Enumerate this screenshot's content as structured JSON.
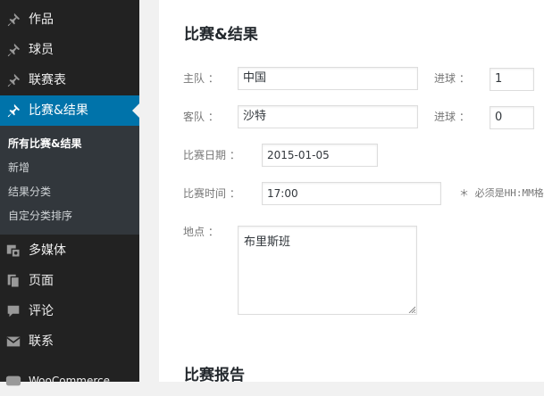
{
  "sidebar": {
    "items": [
      {
        "label": "作品",
        "icon": "pin-icon"
      },
      {
        "label": "球员",
        "icon": "pin-icon"
      },
      {
        "label": "联赛表",
        "icon": "pin-icon"
      },
      {
        "label": "比赛&结果",
        "icon": "pin-icon",
        "active": true
      },
      {
        "label": "多媒体",
        "icon": "media-icon"
      },
      {
        "label": "页面",
        "icon": "pages-icon"
      },
      {
        "label": "评论",
        "icon": "comment-icon"
      },
      {
        "label": "联系",
        "icon": "mail-icon"
      },
      {
        "label": "WooCommerce",
        "icon": "woo-icon"
      }
    ],
    "submenu": [
      {
        "label": "所有比赛&结果",
        "current": true
      },
      {
        "label": "新增"
      },
      {
        "label": "结果分类"
      },
      {
        "label": "自定分类排序"
      }
    ]
  },
  "section1": {
    "title": "比赛&结果",
    "home_label": "主队 ：",
    "home_value": "中国",
    "home_goals_label": "进球 ：",
    "home_goals_value": "1",
    "away_label": "客队 ：",
    "away_value": "沙特",
    "away_goals_label": "进球 ：",
    "away_goals_value": "0",
    "date_label": "比赛日期 ：",
    "date_value": "2015-01-05",
    "time_label": "比赛时间 ：",
    "time_value": "17:00",
    "time_hint": "＊ 必须是HH:MM格式",
    "place_label": "地点 ：",
    "place_value": "布里斯班"
  },
  "section2": {
    "title": "比赛报告"
  },
  "colors": {
    "sidebar": "#222222",
    "submenu": "#32373c",
    "accent": "#0073aa"
  }
}
